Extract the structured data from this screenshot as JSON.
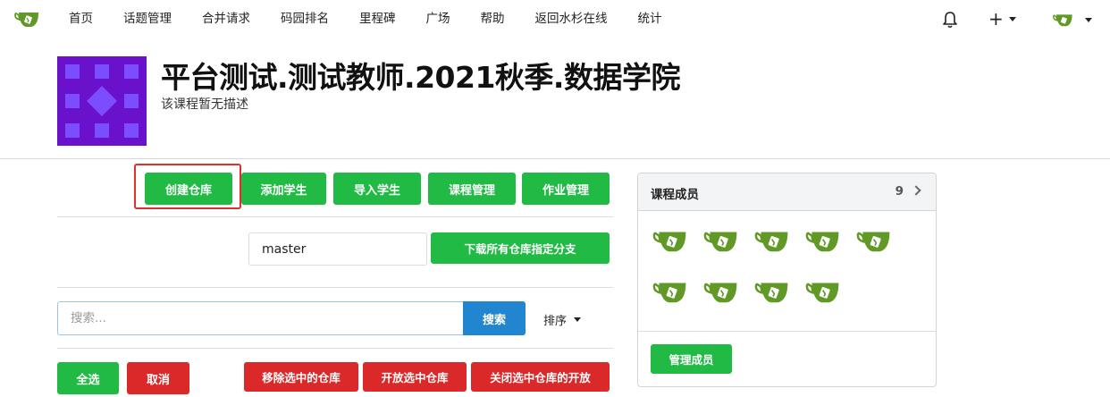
{
  "nav": {
    "items": [
      "首页",
      "话题管理",
      "合并请求",
      "码园排名",
      "里程碑",
      "广场",
      "帮助",
      "返回水杉在线",
      "统计"
    ],
    "logo_icon": "gitea-teacup-icon",
    "bell_icon": "bell-icon",
    "plus_label": "+",
    "brand_color": "#609926"
  },
  "course": {
    "title": "平台测试.测试教师.2021秋季.数据学院",
    "description": "该课程暂无描述",
    "avatar_color": "#6a11cb"
  },
  "toolbar": {
    "create_repo": "创建仓库",
    "add_students": "添加学生",
    "import_students": "导入学生",
    "course_manage": "课程管理",
    "homework_manage": "作业管理"
  },
  "branch": {
    "value": "master",
    "download_label": "下载所有仓库指定分支"
  },
  "search": {
    "placeholder": "搜索...",
    "button_label": "搜索",
    "sort_label": "排序"
  },
  "bulk": {
    "select_all": "全选",
    "cancel": "取消",
    "remove_selected": "移除选中的仓库",
    "open_selected": "开放选中仓库",
    "close_selected": "关闭选中仓库的开放"
  },
  "members_card": {
    "title": "课程成员",
    "count": "9",
    "manage_label": "管理成员",
    "member_icon": "gitea-teacup-icon",
    "member_total": 9
  },
  "colors": {
    "green": "#21ba45",
    "red": "#db2828",
    "blue": "#2185d0",
    "highlight": "#e0302a"
  }
}
